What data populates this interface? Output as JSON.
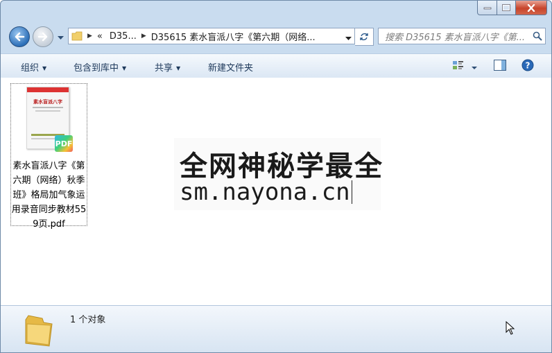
{
  "window": {
    "caption_buttons": [
      "minimize",
      "maximize",
      "close"
    ]
  },
  "address_bar": {
    "overflow_chevron": "«",
    "crumbs": [
      "D35...",
      "D35615 素水盲派八字《第六期（网络..."
    ],
    "search_placeholder": "搜索 D35615 素水盲派八字《第..."
  },
  "toolbar": {
    "organize": "组织",
    "include_in_library": "包含到库中",
    "share": "共享",
    "new_folder": "新建文件夹"
  },
  "content": {
    "files": [
      {
        "name": "素水盲派八字《第六期（网络）秋季班》格局加气象运用录音同步教材559页.pdf",
        "badge": "PDF",
        "thumb_title": "素水盲派八字"
      }
    ],
    "watermark": {
      "line1": "全网神秘学最全",
      "line2": "sm.nayona.cn"
    }
  },
  "details": {
    "status": "1 个对象"
  },
  "colors": {
    "accent": "#1e395b",
    "close_red": "#c7442b",
    "window_frame": "#c9dcef"
  }
}
